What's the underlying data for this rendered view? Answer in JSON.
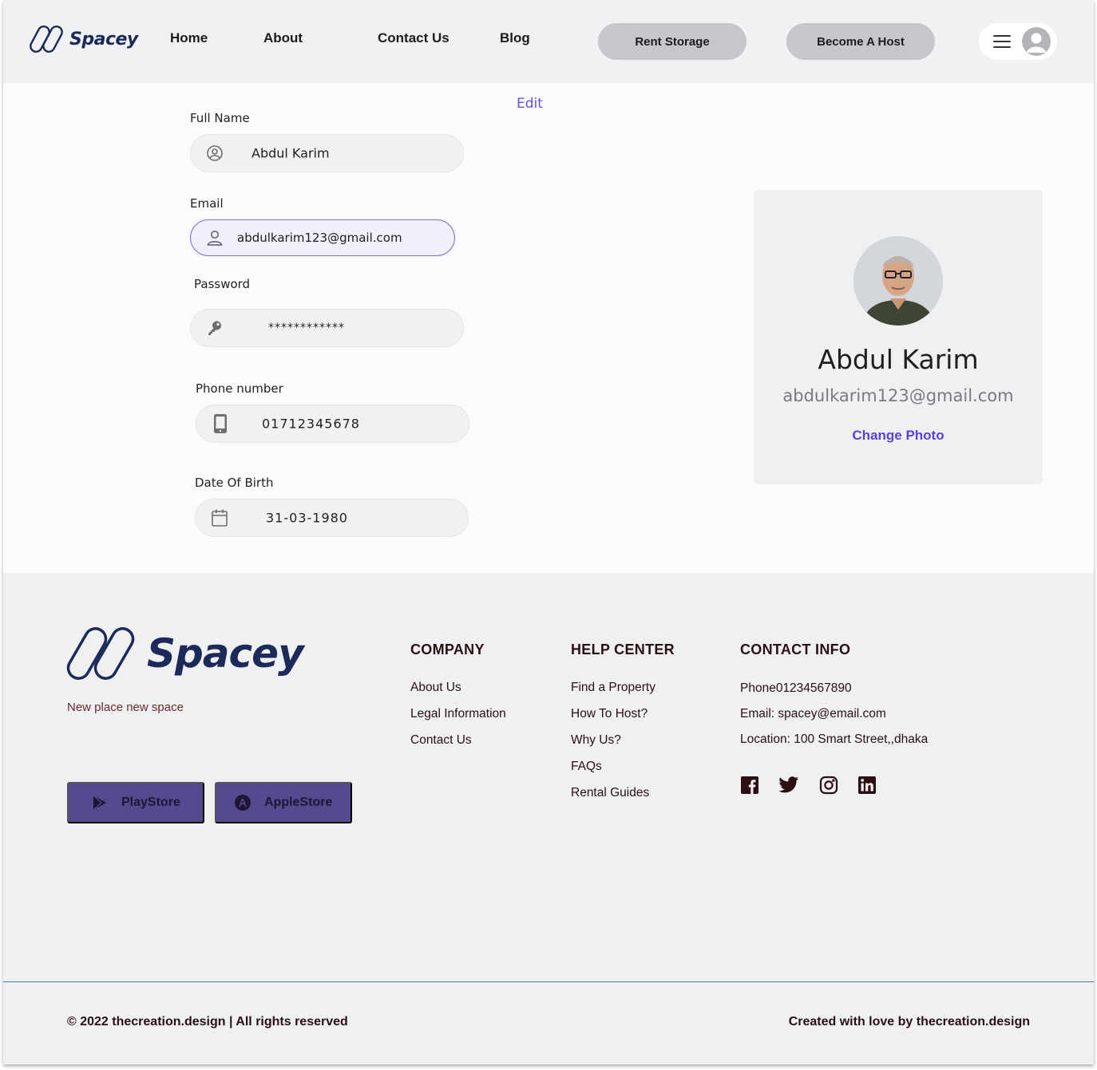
{
  "header": {
    "logo_text": "Spacey",
    "nav": [
      "Home",
      "About",
      "Contact Us",
      "Blog"
    ],
    "rent_storage": "Rent Storage",
    "become_host": "Become A Host"
  },
  "form": {
    "edit_label": "Edit",
    "full_name_label": "Full Name",
    "full_name_value": "Abdul Karim",
    "email_label": "Email",
    "email_value": "abdulkarim123@gmail.com",
    "password_label": "Password",
    "password_value": "************",
    "phone_label": "Phone number",
    "phone_value": "01712345678",
    "dob_label": "Date Of Birth",
    "dob_value": "31-03-1980"
  },
  "profile": {
    "name": "Abdul Karim",
    "email": "abdulkarim123@gmail.com",
    "change_photo": "Change Photo"
  },
  "footer": {
    "logo_text": "Spacey",
    "tagline": "New place new  space",
    "playstore": "PlayStore",
    "applestore": "AppleStore",
    "company": {
      "title": "COMPANY",
      "links": [
        "About Us",
        "Legal Information",
        "Contact Us"
      ]
    },
    "help": {
      "title": "HELP CENTER",
      "links": [
        "Find a Property",
        "How To Host?",
        "Why Us?",
        "FAQs",
        "Rental Guides"
      ]
    },
    "contact": {
      "title": "CONTACT INFO",
      "phone": "Phone01234567890",
      "email": "Email: spacey@email.com",
      "location": "Location: 100 Smart Street,,dhaka"
    },
    "social_icons": [
      "facebook-icon",
      "twitter-icon",
      "instagram-icon",
      "linkedin-icon"
    ],
    "copyright": "© 2022 thecreation.design | All rights reserved",
    "credit_prefix": "Created with love by ",
    "credit_brand": "thecreation.design"
  },
  "colors": {
    "accent": "#5b3fd8",
    "brand_navy": "#1c2a5a",
    "store_button": "#534a8f"
  }
}
